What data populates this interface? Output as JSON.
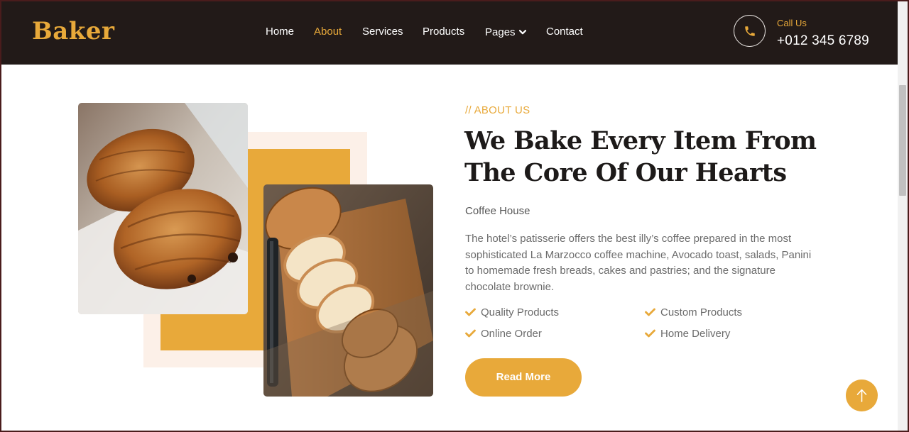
{
  "brand": {
    "name": "Baker",
    "accent_color": "#e8a93a",
    "dark_color": "#221a18"
  },
  "nav": {
    "items": [
      {
        "label": "Home",
        "active": false
      },
      {
        "label": "About",
        "active": true
      },
      {
        "label": "Services",
        "active": false
      },
      {
        "label": "Products",
        "active": false
      },
      {
        "label": "Pages",
        "active": false,
        "has_dropdown": true
      },
      {
        "label": "Contact",
        "active": false
      }
    ]
  },
  "contact": {
    "label": "Call Us",
    "phone": "+012 345 6789",
    "icon": "phone-icon"
  },
  "about": {
    "eyebrow": "// ABOUT US",
    "heading": "We Bake Every Item From The Core Of Our Hearts",
    "subtitle": "Coffee House",
    "description": "The hotel’s patisserie offers the best illy’s coffee prepared in the most sophisticated La Marzocco coffee machine, Avocado toast, salads, Panini to homemade fresh breads, cakes and pastries; and the signature chocolate brownie.",
    "features": [
      "Quality Products",
      "Custom Products",
      "Online Order",
      "Home Delivery"
    ],
    "button": "Read More"
  },
  "images": {
    "left": "croissant-photo",
    "right": "sliced-bread-photo"
  },
  "back_to_top": {
    "icon": "arrow-up-icon"
  }
}
